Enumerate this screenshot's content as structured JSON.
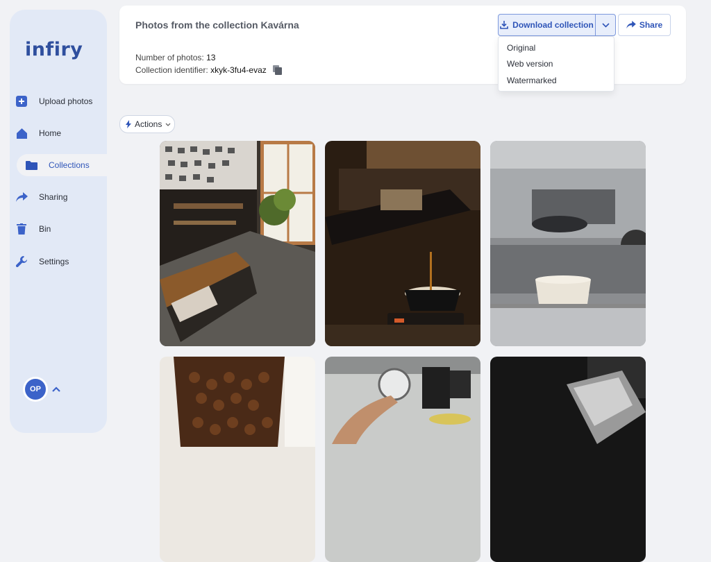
{
  "app": {
    "logo": "infiry"
  },
  "sidebar": {
    "items": [
      {
        "label": "Upload photos",
        "icon": "plus-square-icon"
      },
      {
        "label": "Home",
        "icon": "home-icon"
      },
      {
        "label": "Collections",
        "icon": "folder-icon",
        "active": true
      },
      {
        "label": "Sharing",
        "icon": "share-arrow-icon"
      },
      {
        "label": "Bin",
        "icon": "trash-icon"
      },
      {
        "label": "Settings",
        "icon": "wrench-icon"
      }
    ],
    "user_initials": "OP"
  },
  "header": {
    "title": "Photos from the collection Kavárna",
    "photo_count_label": "Number of photos:",
    "photo_count": "13",
    "identifier_label": "Collection identifier:",
    "identifier": "xkyk-3fu4-evaz",
    "download_label": "Download collection",
    "share_label": "Share",
    "download_options": [
      "Original",
      "Web version",
      "Watermarked"
    ]
  },
  "toolbar": {
    "actions_label": "Actions"
  },
  "gallery": {
    "photos": [
      {
        "subject": "cafe-interior-overhead"
      },
      {
        "subject": "espresso-pouring-dark-cup"
      },
      {
        "subject": "espresso-machine-white-cup"
      },
      {
        "subject": "coffee-beans-grinder"
      },
      {
        "subject": "hand-pressure-gauge"
      },
      {
        "subject": "milk-pitcher-dark"
      }
    ]
  },
  "colors": {
    "accent": "#2f55b8",
    "sidebar": "#e2e9f6",
    "background": "#f1f2f5"
  }
}
